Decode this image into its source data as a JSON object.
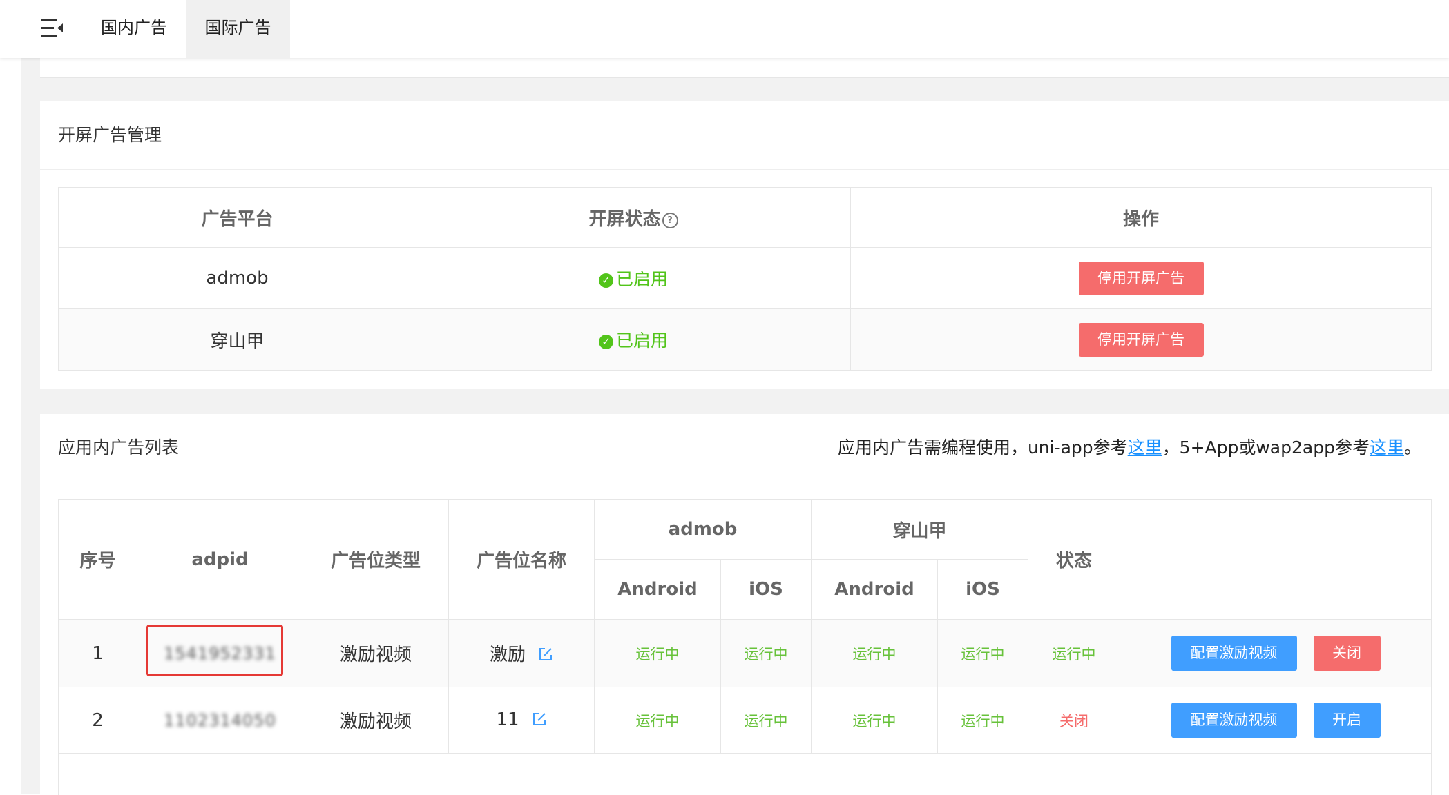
{
  "tabs": {
    "domestic": "国内广告",
    "international": "国际广告"
  },
  "icons": {
    "menu": "menu-fold-icon",
    "help": "question-circle-icon",
    "check": "check-circle-icon",
    "edit": "edit-icon"
  },
  "colors": {
    "success": "#52c41a",
    "danger": "#f56c6c",
    "primary": "#409eff",
    "link": "#1890ff"
  },
  "splash": {
    "title": "开屏广告管理",
    "headers": {
      "platform": "广告平台",
      "status": "开屏状态",
      "action": "操作"
    },
    "rows": [
      {
        "platform": "admob",
        "status": "已启用",
        "action": "停用开屏广告"
      },
      {
        "platform": "穿山甲",
        "status": "已启用",
        "action": "停用开屏广告"
      }
    ]
  },
  "inapp": {
    "title": "应用内广告列表",
    "note": {
      "prefix": "应用内广告需编程使用，uni-app参考",
      "link1": "这里",
      "middle": "，5+App或wap2app参考",
      "link2": "这里",
      "suffix": "。"
    },
    "headers": {
      "index": "序号",
      "adpid": "adpid",
      "type": "广告位类型",
      "name": "广告位名称",
      "admob": "admob",
      "pangle": "穿山甲",
      "android": "Android",
      "ios": "iOS",
      "status": "状态"
    },
    "rows": [
      {
        "index": "1",
        "adpid": "1541952331",
        "type": "激励视频",
        "name": "激励",
        "admob_android": "运行中",
        "admob_ios": "运行中",
        "pangle_android": "运行中",
        "pangle_ios": "运行中",
        "status": "运行中",
        "config_button": "配置激励视频",
        "toggle_button": "关闭"
      },
      {
        "index": "2",
        "adpid": "1102314050",
        "type": "激励视频",
        "name": "11",
        "admob_android": "运行中",
        "admob_ios": "运行中",
        "pangle_android": "运行中",
        "pangle_ios": "运行中",
        "status": "关闭",
        "config_button": "配置激励视频",
        "toggle_button": "开启"
      }
    ]
  }
}
